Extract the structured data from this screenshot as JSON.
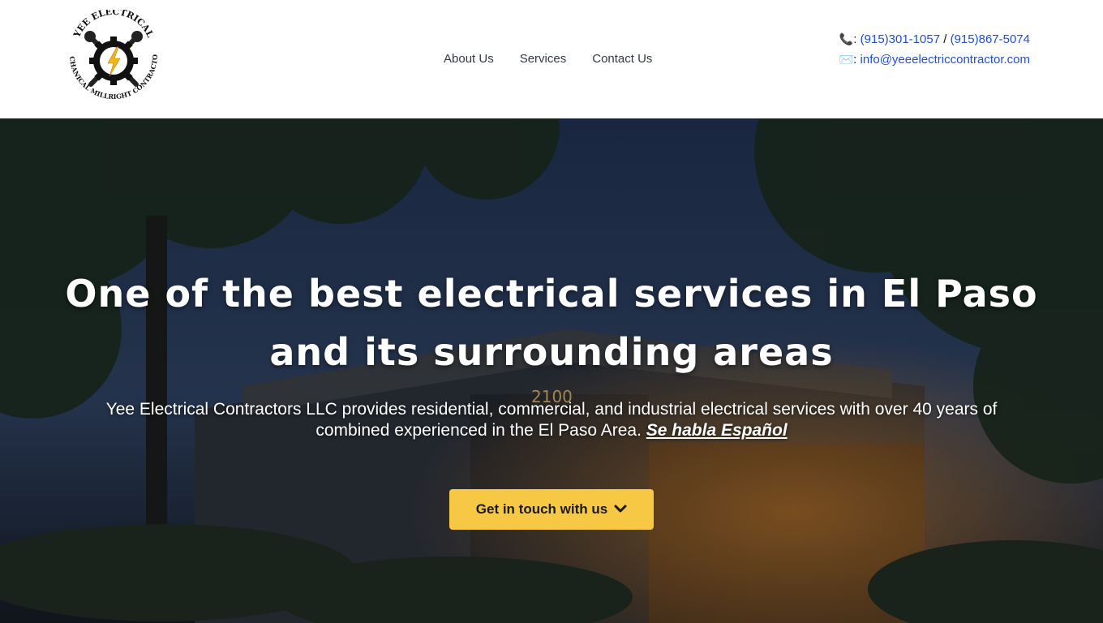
{
  "logo": {
    "arc_top_text": "YEE ELECTRICAL",
    "arc_bottom_text": "MECHANICAL MILLRIGHT CONTRACTORS"
  },
  "nav": {
    "items": [
      {
        "label": "About Us"
      },
      {
        "label": "Services"
      },
      {
        "label": "Contact Us"
      }
    ]
  },
  "contact": {
    "phone_icon": "phone-icon",
    "email_icon": "envelope-icon",
    "phone_1": "(915)301-1057",
    "separator": "/",
    "phone_2": "(915)867-5074",
    "email": "info@yeeelectriccontractor.com"
  },
  "hero": {
    "title_line_1": "One of the best electrical services in El Paso",
    "title_line_2": "and its surrounding areas",
    "subtitle": "Yee Electrical Contractors LLC provides residential, commercial, and industrial electrical services with over 40 years of combined experienced in the El Paso Area.",
    "subtitle_spanish": "Se habla Español",
    "cta_label": "Get in touch with us",
    "cta_icon": "chevron-down-icon",
    "background_image": "night-exterior-of-restaurant-with-trees-photo",
    "building_number": "2100"
  },
  "colors": {
    "accent_yellow": "#f7c843",
    "link_blue": "#2350c8",
    "nav_text": "#333a44"
  }
}
